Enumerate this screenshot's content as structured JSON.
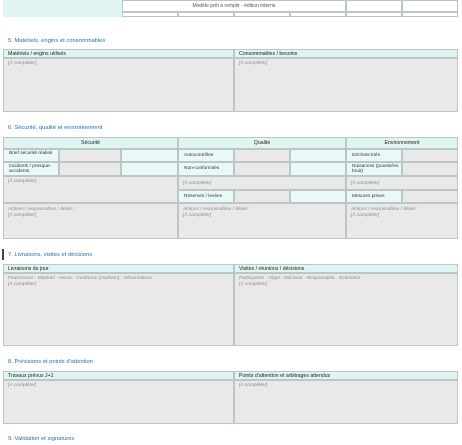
{
  "topbar": {
    "model_text": "Modèle prêt à remplir - édition interne"
  },
  "sec5": {
    "title": "5. Matériels, engins et consommables",
    "col_left": "Matériels / engins utilisés",
    "col_right": "Consommables / besoins",
    "ph_left": "[À compléter]",
    "ph_right": "[À compléter]"
  },
  "sec6": {
    "title": "6. Sécurité, qualité et environnement",
    "h_securite": "Sécurité",
    "h_qualite": "Qualité",
    "h_env": "Environnement",
    "l_brief": "Brief sécurité réalisé",
    "l_incidents": "Incidents / presque-accidents",
    "l_autocontroles": "Autocontrôles",
    "l_nonconf": "Non-conformités",
    "l_reserves": "Réserves / levées",
    "l_dechets": "Déchets triés",
    "l_nuisances": "Nuisances (poussière, bruit)",
    "l_mesures": "Mesures prises",
    "ph_sec": "[À compléter]",
    "ph_qual": "[À compléter]",
    "ph_env": "[À compléter]",
    "actions_label": "Actions / responsables / délais :",
    "ph_act_sec": "[À compléter]",
    "ph_act_qual": "[À compléter]",
    "ph_act_env": "[À compléter]"
  },
  "sec7": {
    "title": "7. Livraisons, visites et décisions",
    "col_left": "Livraisons du jour",
    "col_right": "Visites / réunions / décisions",
    "hint_left": "Fournisseur - Matériel - Heure - Conforme (Oui/Non) - Observations",
    "hint_right": "Participants - Objet - Décision - Responsable - Échéance",
    "ph_left": "[À compléter]",
    "ph_right": "[À compléter]"
  },
  "sec8": {
    "title": "8. Prévisions et points d'attention",
    "col_left": "Travaux prévus J+1",
    "col_right": "Points d'attention et arbitrages attendus",
    "ph_left": "[À compléter]",
    "ph_right": "[À compléter]"
  },
  "sec9": {
    "title": "9. Validation et signatures"
  }
}
